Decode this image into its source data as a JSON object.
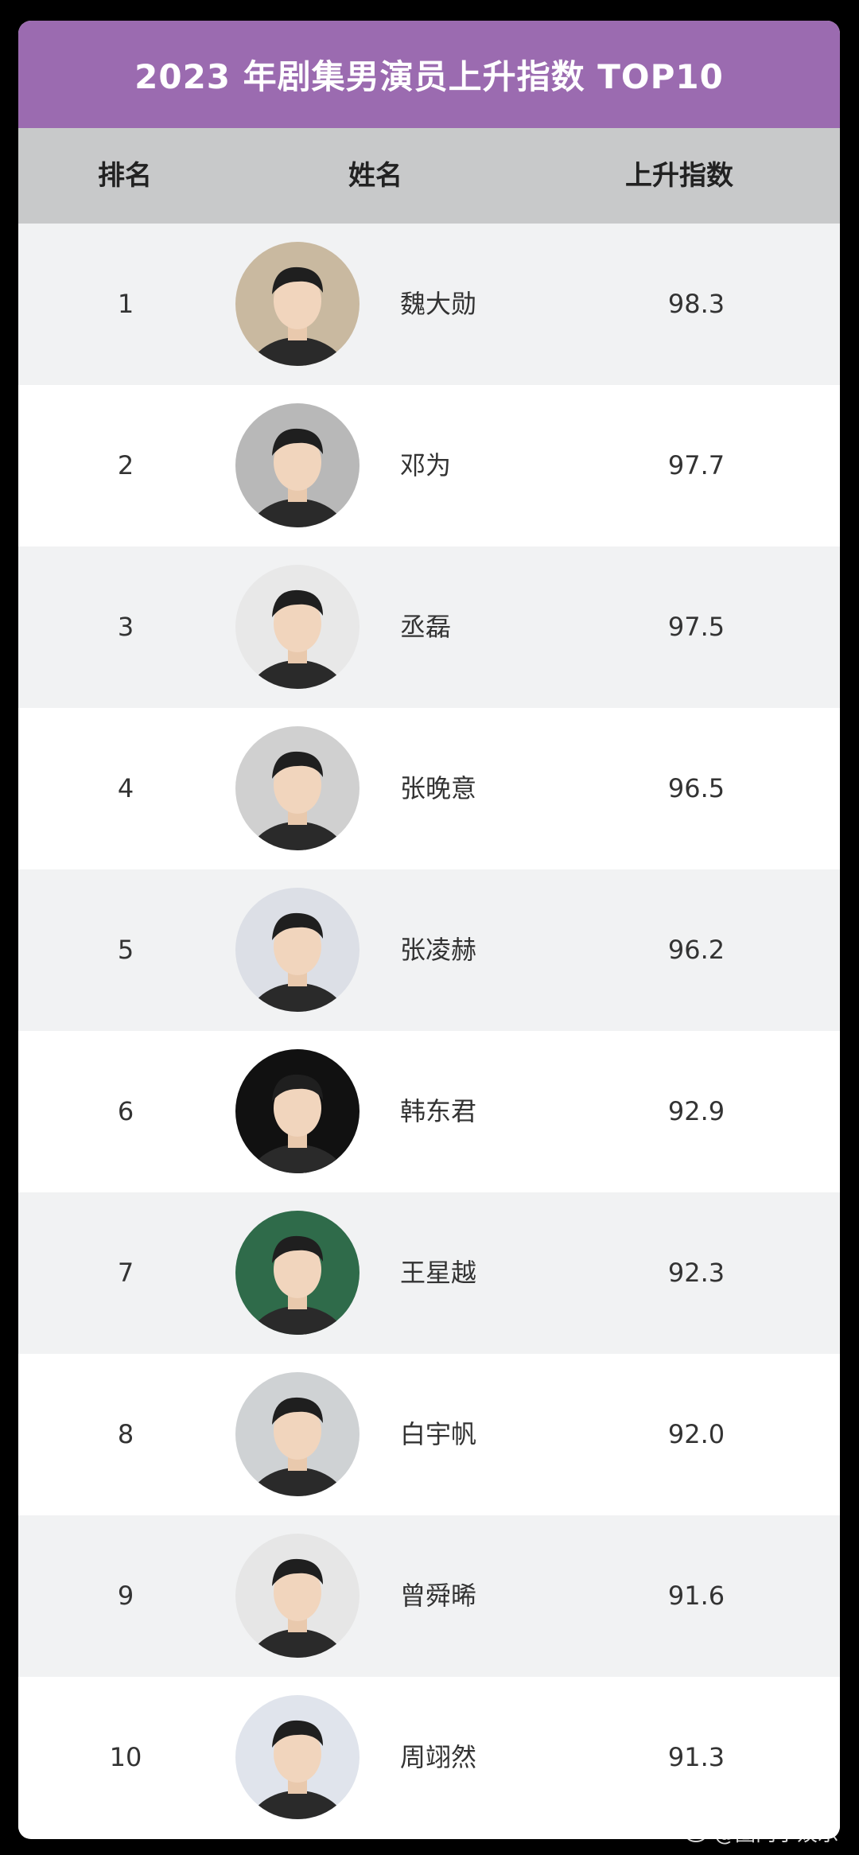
{
  "title": "2023 年剧集男演员上升指数 TOP10",
  "headers": {
    "rank": "排名",
    "name": "姓名",
    "index": "上升指数"
  },
  "rows": [
    {
      "rank": "1",
      "name": "魏大勋",
      "score": "98.3",
      "avatar_bg": "#c9b9a0"
    },
    {
      "rank": "2",
      "name": "邓为",
      "score": "97.7",
      "avatar_bg": "#b8b8b8"
    },
    {
      "rank": "3",
      "name": "丞磊",
      "score": "97.5",
      "avatar_bg": "#e8e8e8"
    },
    {
      "rank": "4",
      "name": "张晚意",
      "score": "96.5",
      "avatar_bg": "#d0d0d0"
    },
    {
      "rank": "5",
      "name": "张凌赫",
      "score": "96.2",
      "avatar_bg": "#dcdfe6"
    },
    {
      "rank": "6",
      "name": "韩东君",
      "score": "92.9",
      "avatar_bg": "#111111"
    },
    {
      "rank": "7",
      "name": "王星越",
      "score": "92.3",
      "avatar_bg": "#2f6b4a"
    },
    {
      "rank": "8",
      "name": "白宇帆",
      "score": "92.0",
      "avatar_bg": "#cfd2d4"
    },
    {
      "rank": "9",
      "name": "曾舜晞",
      "score": "91.6",
      "avatar_bg": "#e6e6e6"
    },
    {
      "rank": "10",
      "name": "周翊然",
      "score": "91.3",
      "avatar_bg": "#e0e4ec"
    }
  ],
  "watermark": "@圈内小娱乐",
  "colors": {
    "title_bar": "#9b6bb0",
    "header_row": "#c8c9ca",
    "row_odd": "#f1f2f3",
    "row_even": "#ffffff"
  }
}
